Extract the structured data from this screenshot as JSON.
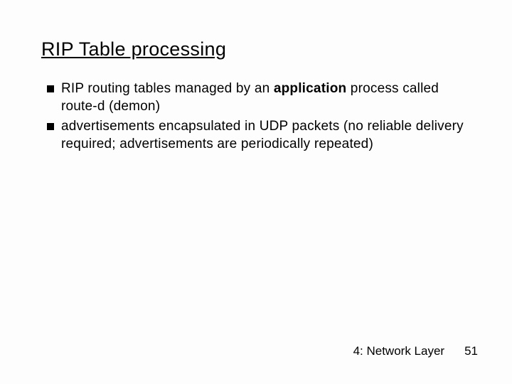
{
  "title": "RIP Table processing",
  "bullets": [
    {
      "pre": "RIP routing tables managed by an ",
      "bold": "application",
      "post": " process called route-d (demon)"
    },
    {
      "pre": "advertisements encapsulated in UDP packets (no reliable delivery required; advertisements are periodically repeated)",
      "bold": "",
      "post": ""
    }
  ],
  "footer": {
    "label": "4: Network Layer",
    "page": "51"
  }
}
